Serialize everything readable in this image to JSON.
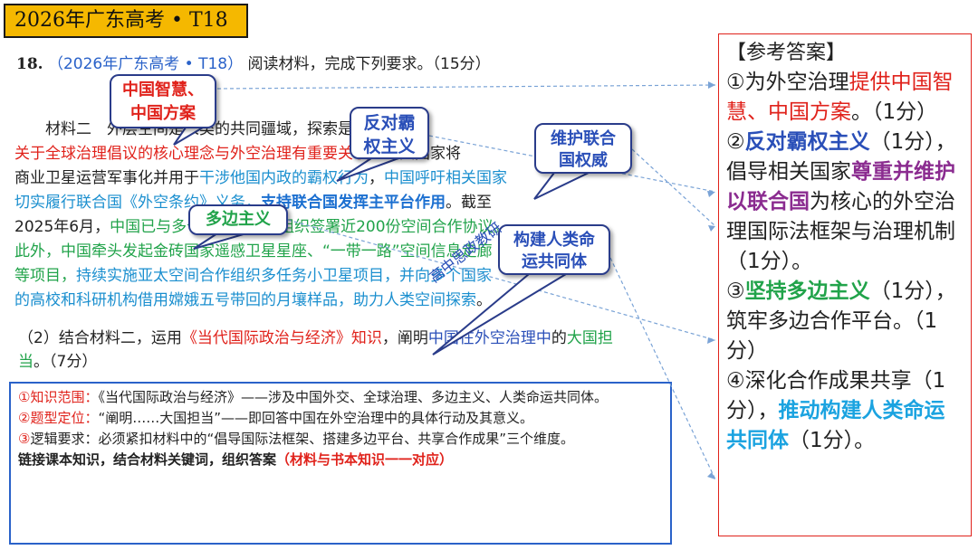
{
  "title": "2026年广东高考 • T18",
  "question": {
    "number": "18.",
    "source": "（2026年广东高考 • T18）",
    "instruction": "阅读材料，完成下列要求。（15分）"
  },
  "material": {
    "lines": [
      [
        {
          "t": "　　材料二　外层空间是人类的共同疆域，探索是人类的",
          "c": ""
        },
        {
          "t": "中国",
          "c": "red"
        }
      ],
      [
        {
          "t": "关于全球治理倡议的核心理念与外空治理有重要关联",
          "c": "red"
        },
        {
          "t": "。相关国家将",
          "c": ""
        }
      ],
      [
        {
          "t": "商业卫星运营军事化并用于",
          "c": ""
        },
        {
          "t": "干涉他国内政的霸权行为",
          "c": "cyan"
        },
        {
          "t": "，",
          "c": ""
        },
        {
          "t": "中国呼吁相关国家",
          "c": "cyan"
        }
      ],
      [
        {
          "t": "切实履行联合国《外空条约》义务，",
          "c": "cyan"
        },
        {
          "t": "支持联合国发挥主平台作用",
          "c": "strong-blue"
        },
        {
          "t": "。截至",
          "c": ""
        }
      ],
      [
        {
          "t": "2025年6月，",
          "c": ""
        },
        {
          "t": "中国已与多个国家和国际组织签署近200份空间合作协议。",
          "c": "green"
        }
      ],
      [
        {
          "t": "此外，中国牵头发起金砖国家遥感卫星星座、“一带一路”空间信息走廊",
          "c": "green"
        }
      ],
      [
        {
          "t": "等项目，",
          "c": "green"
        },
        {
          "t": "持续实施亚太空间合作组织多任务小卫星项目，并向多个国家",
          "c": "cyan"
        }
      ],
      [
        {
          "t": "的高校和科研机构借用嫦娥五号带回的月壤样品，助力人类空间探索",
          "c": "cyan"
        },
        {
          "t": "。",
          "c": ""
        }
      ]
    ]
  },
  "q2": {
    "prefix": "（2）结合材料二，运用",
    "book": "《当代国际政治与经济》知识",
    "mid": "，阐明",
    "subject": "中国在外空治理中",
    "de": "的",
    "role": "大国担当",
    "score": "。（7分）"
  },
  "analysis": {
    "item1_num": "①",
    "item1_label": "知识范围：",
    "item1_text": "《当代国际政治与经济》——涉及中国外交、全球治理、多边主义、人类命运共同体。",
    "item2_num": "②",
    "item2_label": "题型定位：",
    "item2_text": "“阐明……大国担当”——即回答中国在外空治理中的具体行动及其意义。",
    "item3_num": "③",
    "item3_text": "逻辑要求：必须紧扣材料中的“倡导国际法框架、搭建多边平台、共享合作成果”三个维度。",
    "summary": "链接课本知识，结合材料关键词，组织答案",
    "summary_note": "（材料与书本知识一一对应）"
  },
  "answer": {
    "header": "【参考答案】",
    "a1_pre": "①为外空治理",
    "a1_hl": "提供中国智慧、中国方案",
    "a1_post": "。（1分）",
    "a2_num": "②",
    "a2_hl": "反对霸权主义",
    "a2_mid": "（1分），倡导相关国家",
    "a2_hl2": "尊重并维护以联合国",
    "a2_post": "为核心的外空治理国际法框架与治理机制（1分）。",
    "a3_num": "③",
    "a3_hl": "坚持多边主义",
    "a3_post": "（1分），筑牢多边合作平台。（1分）",
    "a4_pre": "④深化合作成果共享（1分），",
    "a4_hl": "推动构建人类命运共同体",
    "a4_post": "（1分）。"
  },
  "callouts": {
    "c1": "中国智慧、\n中国方案",
    "c2": "反对霸\n权主义",
    "c3": "维护联合\n国权威",
    "c4": "多边主义",
    "c5": "构建人类命\n运共同体"
  },
  "watermark": "高中思政教研"
}
